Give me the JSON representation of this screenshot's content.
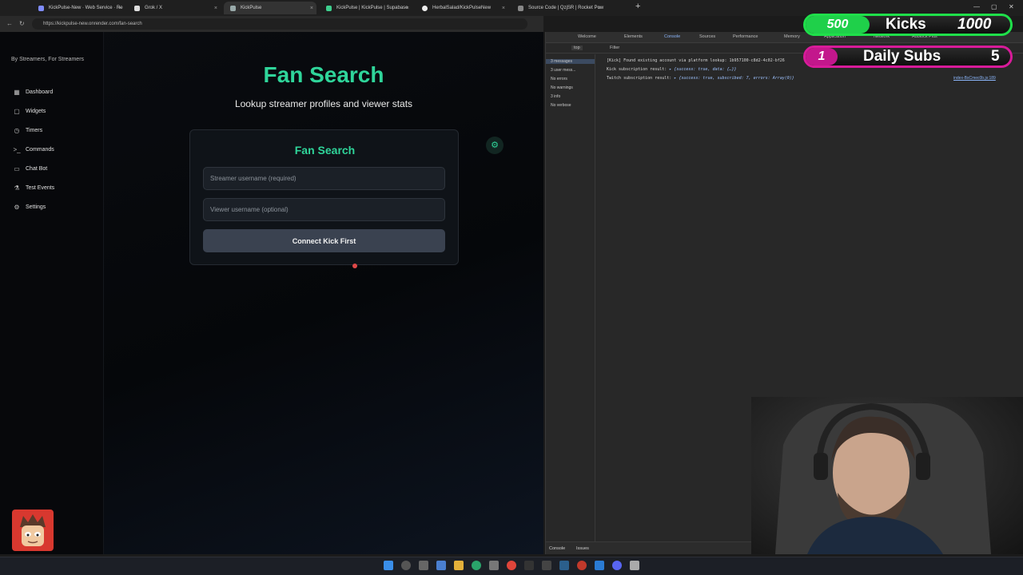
{
  "browser": {
    "tabs": [
      {
        "title": "KickPulse-New · Web Service · Re"
      },
      {
        "title": "Grok / X"
      },
      {
        "title": "KickPulse"
      },
      {
        "title": "KickPulse | KickPulse | Supabase"
      },
      {
        "title": "HerbalSalad/KickPulseNew"
      },
      {
        "title": "Source Code | QzjSR | Rocket Pow"
      }
    ],
    "new_tab_label": "+",
    "url": "https://kickpulse-new.onrender.com/fan-search"
  },
  "app": {
    "tagline": "By Streamers, For Streamers",
    "nav": [
      {
        "label": "Dashboard",
        "icon": "dashboard-icon",
        "glyph": "▦"
      },
      {
        "label": "Widgets",
        "icon": "widgets-icon",
        "glyph": "▢"
      },
      {
        "label": "Timers",
        "icon": "clock-icon",
        "glyph": "◷"
      },
      {
        "label": "Commands",
        "icon": "terminal-icon",
        "glyph": ">_"
      },
      {
        "label": "Chat Bot",
        "icon": "chat-icon",
        "glyph": "▭"
      },
      {
        "label": "Test Events",
        "icon": "flask-icon",
        "glyph": "⚗"
      },
      {
        "label": "Settings",
        "icon": "gear-icon",
        "glyph": "⚙"
      }
    ],
    "title": "Fan Search",
    "subtitle": "Lookup streamer profiles and viewer stats",
    "card": {
      "title": "Fan Search",
      "streamer_placeholder": "Streamer username (required)",
      "viewer_placeholder": "Viewer username (optional)",
      "button_label": "Connect Kick First"
    },
    "accent_color": "#2fd59a"
  },
  "devtools": {
    "tabs": [
      "Welcome",
      "Elements",
      "Console",
      "Sources",
      "Performance",
      "Memory",
      "Application",
      "Network",
      "Adblock Plus"
    ],
    "active_tab": "Console",
    "context": "top",
    "filter_placeholder": "Filter",
    "sidebar": [
      "3 messages",
      "3 user mess...",
      "No errors",
      "No warnings",
      "3 info",
      "No verbose"
    ],
    "logs": [
      {
        "text": "[Kick] Found existing account via platform lookup: 1b957100-c8d2-4c02-bf26",
        "obj": "",
        "link": ""
      },
      {
        "text": "Kick subscription result:",
        "obj": "▸ {success: true, data: {…}}",
        "link": ""
      },
      {
        "text": "Twitch subscription result:",
        "obj": "▸ {success: true, subscribed: 7, errors: Array(0)}",
        "link": "index-BsCmec0b.js:189"
      }
    ],
    "bottom_tabs": [
      "Console",
      "Issues"
    ]
  },
  "overlay": {
    "kicks": {
      "current": "500",
      "label": "Kicks",
      "goal": "1000"
    },
    "subs": {
      "current": "1",
      "label": "Daily Subs",
      "goal": "5"
    }
  }
}
